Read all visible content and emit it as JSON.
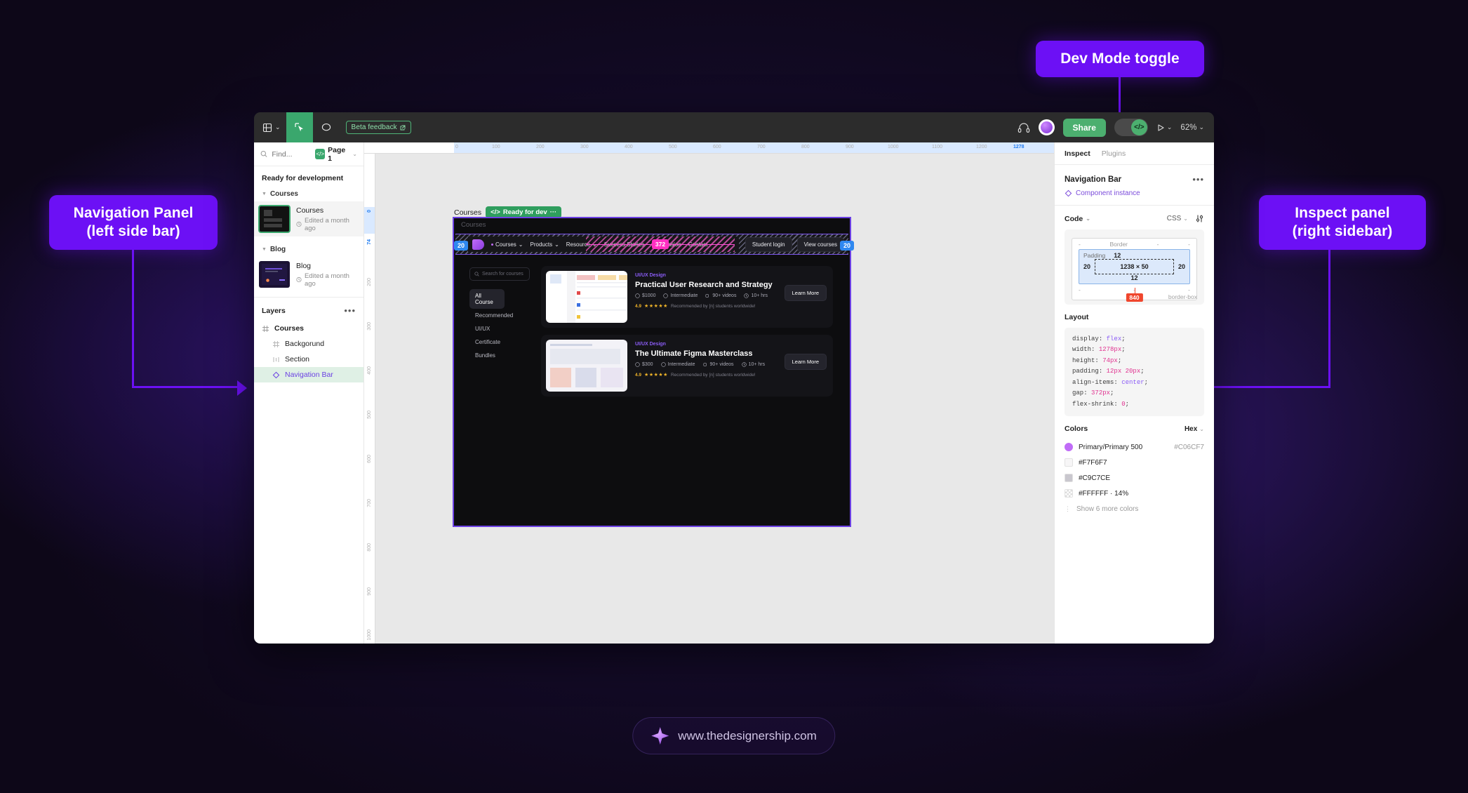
{
  "callouts": {
    "dev_mode": "Dev Mode toggle",
    "nav_panel_line1": "Navigation Panel",
    "nav_panel_line2": "(left side bar)",
    "inspect_line1": "Inspect panel",
    "inspect_line2": "(right sidebar)"
  },
  "watermark": {
    "url": "www.thedesignership.com",
    "icon": "sparkle-icon"
  },
  "toolbar": {
    "menu_icon": "figma-menu-icon",
    "chevron": "⌄",
    "cursor_icon": "select-tool-icon",
    "comment_icon": "comment-bubble-icon",
    "beta_label": "Beta feedback",
    "beta_external_icon": "external-link-icon",
    "headset_icon": "headset-icon",
    "avatar": "user-avatar",
    "share_label": "Share",
    "devmode_icon": "</>",
    "present_icon": "▷",
    "present_chevron": "⌄",
    "zoom_label": "62%",
    "zoom_chevron": "⌄"
  },
  "left_panel": {
    "search_placeholder": "Find...",
    "search_icon": "search-icon",
    "page_badge_icon": "</>",
    "page_name": "Page 1",
    "page_chevron": "⌄",
    "section_title": "Ready for development",
    "groups": [
      {
        "label": "Courses",
        "items": [
          {
            "title": "Courses",
            "subtitle": "Edited a month ago",
            "clock_icon": "clock-icon",
            "selected": true
          }
        ]
      },
      {
        "label": "Blog",
        "items": [
          {
            "title": "Blog",
            "subtitle": "Edited a month ago",
            "clock_icon": "clock-icon",
            "selected": false
          }
        ]
      }
    ],
    "layers_title": "Layers",
    "layers_menu_icon": "more-options-icon",
    "layers": [
      {
        "label": "Courses",
        "icon": "frame-icon",
        "level": 0,
        "active": false
      },
      {
        "label": "Backgorund",
        "icon": "frame-icon",
        "level": 1,
        "active": false
      },
      {
        "label": "Section",
        "icon": "section-icon",
        "level": 1,
        "active": false
      },
      {
        "label": "Navigation Bar",
        "icon": "component-instance-icon",
        "level": 1,
        "active": true
      }
    ]
  },
  "canvas": {
    "ruler_h": [
      "0",
      "100",
      "200",
      "300",
      "400",
      "500",
      "600",
      "700",
      "800",
      "900",
      "1000",
      "1100",
      "1200"
    ],
    "ruler_h_highlight": "1278",
    "ruler_v": [
      "0",
      "74",
      "200",
      "300",
      "400",
      "500",
      "600",
      "700",
      "800",
      "900",
      "1000"
    ],
    "ruler_v_highlight": [
      "0",
      "74"
    ],
    "frame_name": "Courses",
    "ready_chip": "Ready for dev",
    "ready_chip_icon": "</>",
    "ready_chip_dots": "···",
    "artboard_label": "Courses",
    "padding_left_badge": "20",
    "padding_right_badge": "20",
    "gap_badge": "372",
    "nav_links": [
      {
        "label": "Courses",
        "chevron": "⌄",
        "dot": true
      },
      {
        "label": "Products",
        "chevron": "⌄",
        "dot": false
      },
      {
        "label": "Resource",
        "chevron": "⌄",
        "dot": false
      },
      {
        "label": "Success Stories",
        "chevron": "",
        "dot": false
      },
      {
        "label": "Our Mission",
        "chevron": "",
        "dot": false
      },
      {
        "label": "Contact",
        "chevron": "",
        "dot": false
      }
    ],
    "nav_buttons": [
      "Student login",
      "View courses"
    ],
    "search_placeholder": "Search for courses",
    "search_icon": "search-icon",
    "filters": [
      "All Course",
      "Recommended",
      "UI/UX",
      "Certificate",
      "Bundles"
    ],
    "active_filter": "All Course",
    "courses": [
      {
        "tag": "UI/UX Design",
        "title": "Practical User Research and Strategy",
        "price": "$1000",
        "level": "Intermediate",
        "videos": "90+ videos",
        "duration": "10+ hrs",
        "score": "4.9",
        "stars": "★★★★★",
        "reviews": "Recommended by [n] students worldwide!",
        "cta": "Learn More"
      },
      {
        "tag": "UI/UX Design",
        "title": "The Ultimate Figma Masterclass",
        "price": "$300",
        "level": "Intermediate",
        "videos": "90+ videos",
        "duration": "10+ hrs",
        "score": "4.9",
        "stars": "★★★★★",
        "reviews": "Recommended by [n] students worldwide!",
        "cta": "Learn More"
      }
    ]
  },
  "right_panel": {
    "tabs": [
      {
        "label": "Inspect",
        "active": true
      },
      {
        "label": "Plugins",
        "active": false
      }
    ],
    "selection_title": "Navigation Bar",
    "selection_menu_icon": "more-options-icon",
    "instance_label": "Component instance",
    "instance_icon": "component-instance-icon",
    "code_section": {
      "label": "Code",
      "chevron": "⌄",
      "language": "CSS",
      "language_chevron": "⌄",
      "settings_icon": "sliders-icon"
    },
    "box_model": {
      "border_label": "Border",
      "padding_label": "Padding",
      "padding_top": "12",
      "padding_right": "20",
      "padding_bottom": "12",
      "padding_left": "20",
      "content_size": "1238 × 50",
      "border_dashes": "-",
      "width_badge": "840",
      "box_sizing": "border-box"
    },
    "layout_section": {
      "label": "Layout",
      "css": [
        {
          "prop": "display",
          "value": "flex"
        },
        {
          "prop": "width",
          "value": "1278px"
        },
        {
          "prop": "height",
          "value": "74px"
        },
        {
          "prop": "padding",
          "value": "12px 20px"
        },
        {
          "prop": "align-items",
          "value": "center"
        },
        {
          "prop": "gap",
          "value": "372px"
        },
        {
          "prop": "flex-shrink",
          "value": "0"
        }
      ]
    },
    "colors_section": {
      "label": "Colors",
      "format": "Hex",
      "format_chevron": "⌄",
      "items": [
        {
          "name": "Primary/Primary 500",
          "hex": "#C06CF7",
          "swatch": "#C06CF7",
          "type": "round"
        },
        {
          "name": "#F7F6F7",
          "hex": "",
          "swatch": "#F7F6F7",
          "type": "square"
        },
        {
          "name": "#C9C7CE",
          "hex": "",
          "swatch": "#C9C7CE",
          "type": "square"
        },
        {
          "name": "#FFFFFF · 14%",
          "hex": "",
          "swatch": "#FFFFFF",
          "type": "alpha"
        }
      ],
      "show_more": "Show 6 more colors",
      "show_more_icon": "drag-handle-icon"
    }
  }
}
